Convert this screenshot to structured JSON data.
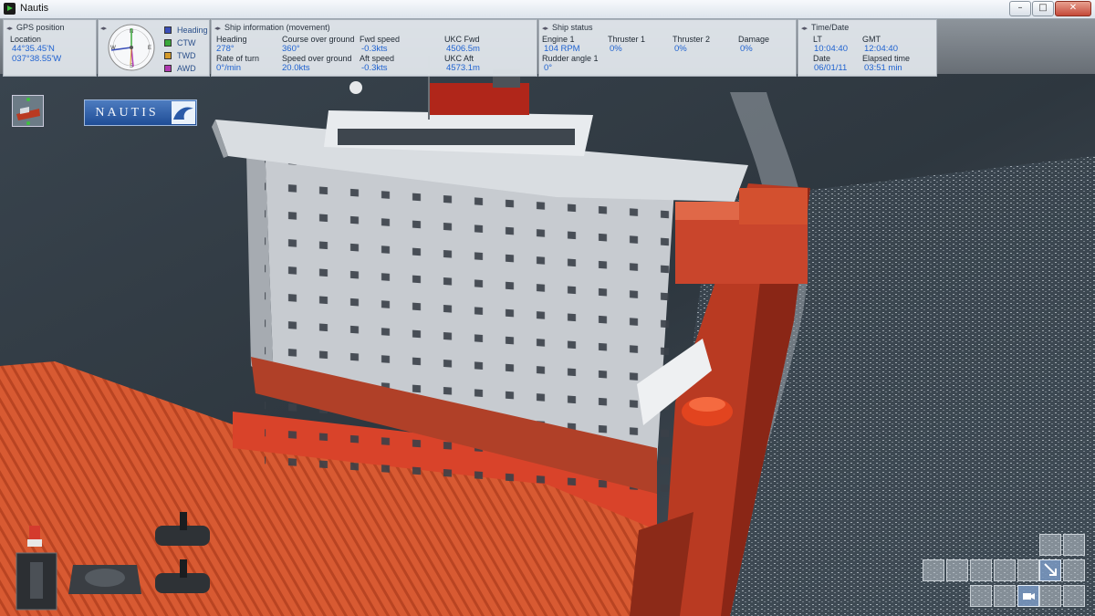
{
  "window": {
    "title": "Nautis",
    "min_glyph": "–",
    "max_glyph": "□",
    "close_glyph": "✕"
  },
  "gps": {
    "header": "GPS position",
    "location_label": "Location",
    "lat": "44°35.45'N",
    "lon": "037°38.55'W"
  },
  "compass": {
    "legend": [
      {
        "label": "Heading",
        "color": "#3b4fb8"
      },
      {
        "label": "CTW",
        "color": "#3aa83a"
      },
      {
        "label": "TWD",
        "color": "#d49a2a"
      },
      {
        "label": "AWD",
        "color": "#b03ab0"
      }
    ],
    "heading_deg": 278
  },
  "ship_info": {
    "header": "Ship information (movement)",
    "heading_label": "Heading",
    "heading_value": "278°",
    "rot_label": "Rate of turn",
    "rot_value": "0°/min",
    "cog_label": "Course over ground",
    "cog_value": "360°",
    "sog_label": "Speed over ground",
    "sog_value": "20.0kts",
    "fwd_label": "Fwd speed",
    "fwd_value": "-0.3kts",
    "aft_label": "Aft speed",
    "aft_value": "-0.3kts",
    "ukc_fwd_label": "UKC Fwd",
    "ukc_fwd_value": "4506.5m",
    "ukc_aft_label": "UKC Aft",
    "ukc_aft_value": "4573.1m"
  },
  "ship_status": {
    "header": "Ship status",
    "engine_label": "Engine 1",
    "engine_value": "104 RPM",
    "rudder_label": "Rudder angle 1",
    "rudder_value": "0°",
    "thr1_label": "Thruster 1",
    "thr1_value": "0%",
    "thr2_label": "Thruster 2",
    "thr2_value": "0%",
    "damage_label": "Damage",
    "damage_value": "0%"
  },
  "time": {
    "header": "Time/Date",
    "lt_label": "LT",
    "lt_value": "10:04:40",
    "gmt_label": "GMT",
    "gmt_value": "12:04:40",
    "date_label": "Date",
    "date_value": "06/01/11",
    "elapsed_label": "Elapsed time",
    "elapsed_value": "03:51 min"
  },
  "logo": {
    "text": "NAUTIS"
  },
  "colors": {
    "value_blue": "#1f62d0",
    "hull_red": "#c9361f",
    "sea": "#3c4a55"
  }
}
